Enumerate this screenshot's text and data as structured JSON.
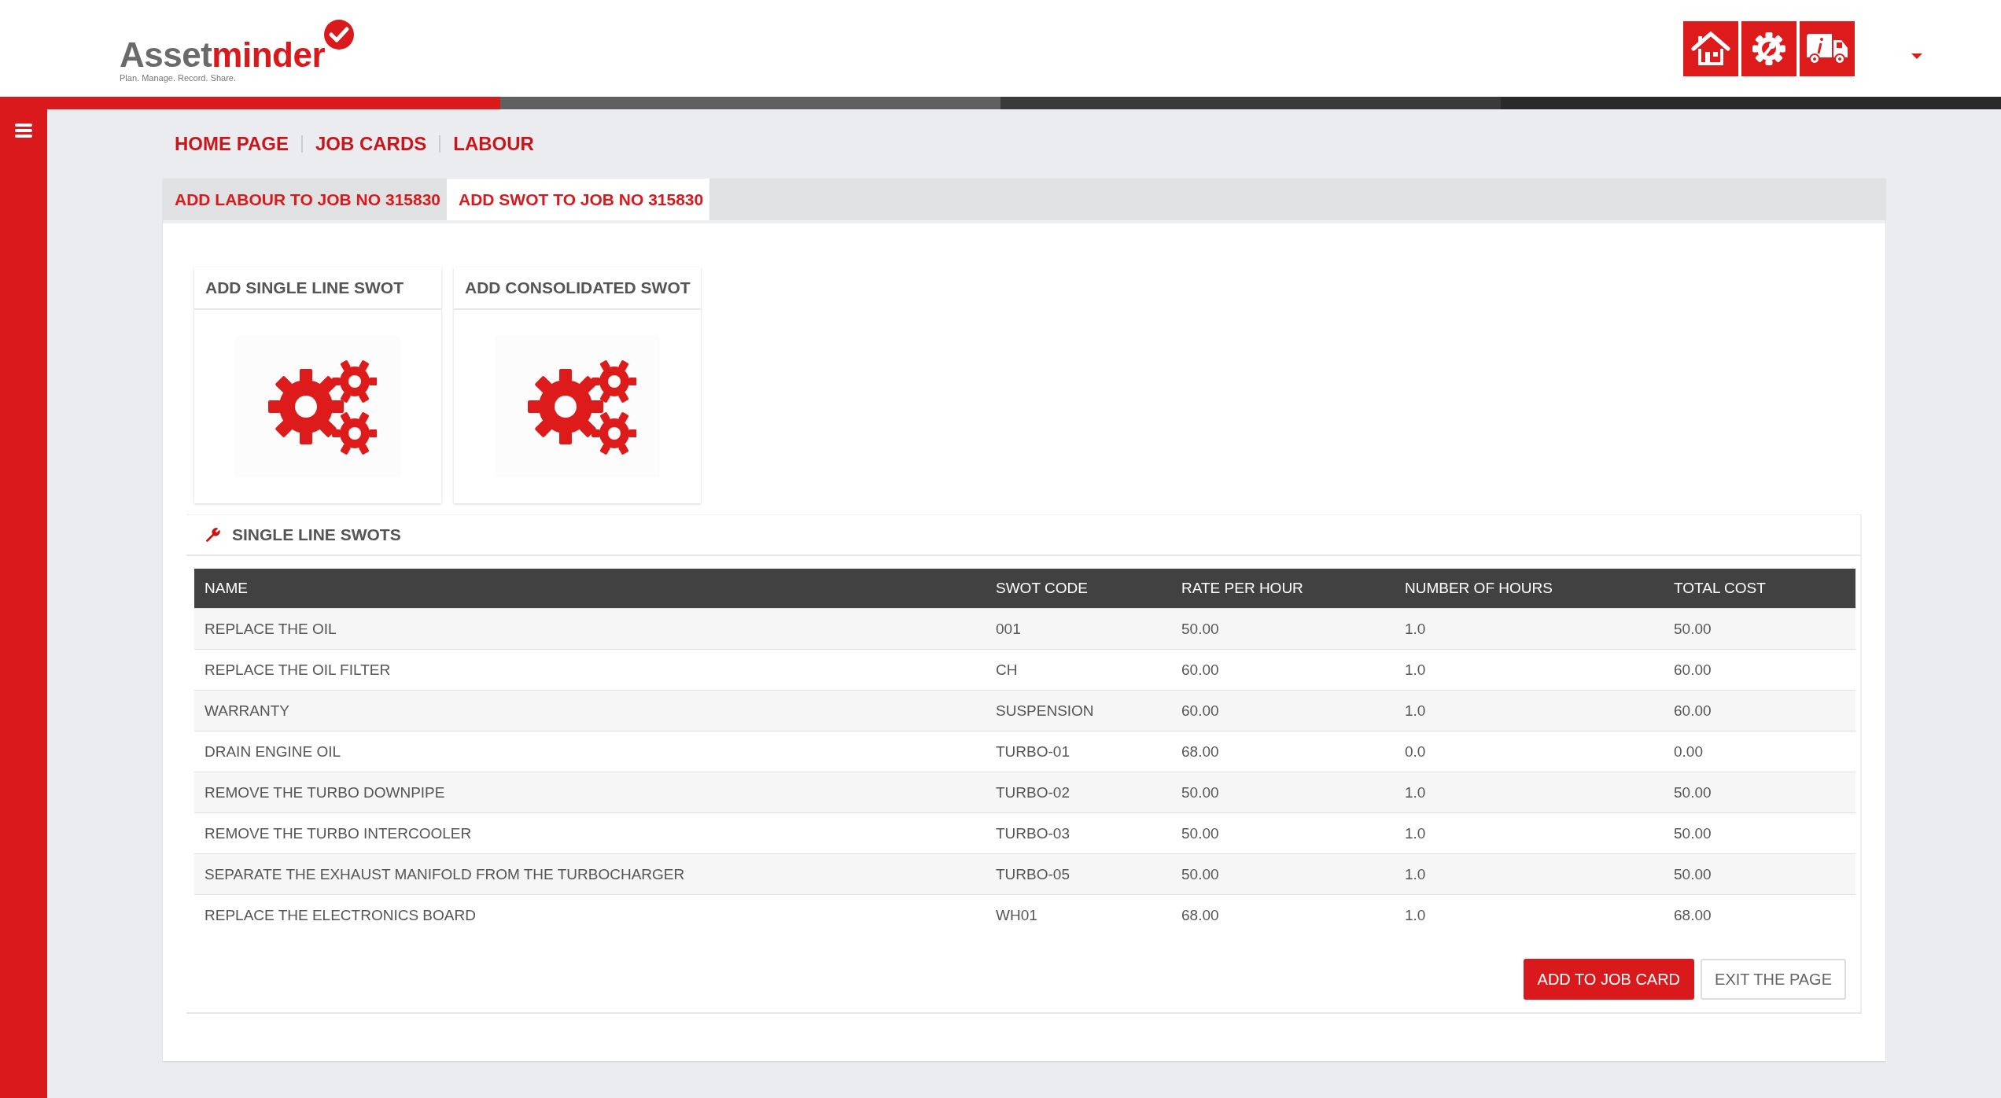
{
  "logo": {
    "word_start": "Asset",
    "word_end": "minder",
    "tagline": "Plan. Manage. Record. Share."
  },
  "header_buttons": [
    {
      "kind": "home"
    },
    {
      "kind": "service"
    },
    {
      "kind": "truck"
    }
  ],
  "breadcrumb": [
    "HOME PAGE",
    "JOB CARDS",
    "LABOUR"
  ],
  "tabs": [
    {
      "label": "ADD LABOUR TO JOB NO 315830",
      "selected": false
    },
    {
      "label": "ADD SWOT TO JOB NO 315830",
      "selected": true
    }
  ],
  "cards": [
    {
      "title": "ADD SINGLE LINE SWOT"
    },
    {
      "title": "ADD CONSOLIDATED SWOT"
    }
  ],
  "section_title": "SINGLE LINE SWOTS",
  "table": {
    "columns": [
      "NAME",
      "SWOT CODE",
      "RATE PER HOUR",
      "NUMBER OF HOURS",
      "TOTAL COST"
    ],
    "rows": [
      [
        "REPLACE THE OIL",
        "001",
        "50.00",
        "1.0",
        "50.00"
      ],
      [
        "REPLACE THE OIL FILTER",
        "CH",
        "60.00",
        "1.0",
        "60.00"
      ],
      [
        "WARRANTY",
        "SUSPENSION",
        "60.00",
        "1.0",
        "60.00"
      ],
      [
        "DRAIN ENGINE OIL",
        "TURBO-01",
        "68.00",
        "0.0",
        "0.00"
      ],
      [
        "REMOVE THE TURBO DOWNPIPE",
        "TURBO-02",
        "50.00",
        "1.0",
        "50.00"
      ],
      [
        "REMOVE THE TURBO INTERCOOLER",
        "TURBO-03",
        "50.00",
        "1.0",
        "50.00"
      ],
      [
        "SEPARATE THE EXHAUST MANIFOLD FROM THE TURBOCHARGER",
        "TURBO-05",
        "50.00",
        "1.0",
        "50.00"
      ],
      [
        "REPLACE THE ELECTRONICS BOARD",
        "WH01",
        "68.00",
        "1.0",
        "68.00"
      ]
    ]
  },
  "buttons": [
    {
      "label": "ADD TO JOB CARD",
      "kind": "primary"
    },
    {
      "label": "EXIT THE PAGE",
      "kind": "default"
    }
  ]
}
